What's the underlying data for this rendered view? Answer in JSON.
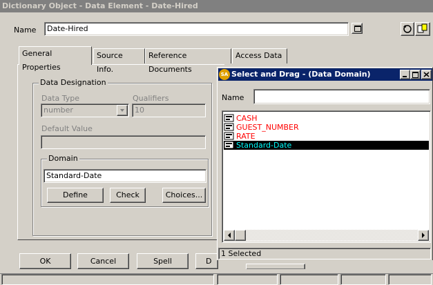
{
  "main_window": {
    "title": "Dictionary Object - Data Element - Date-Hired",
    "name_label": "Name",
    "name_value": "Date-Hired",
    "tabs": [
      {
        "label": "General Properties"
      },
      {
        "label": "Source Info."
      },
      {
        "label": "Reference Documents"
      },
      {
        "label": "Access Data"
      }
    ],
    "data_designation": {
      "legend": "Data Designation",
      "data_type_label": "Data Type",
      "data_type_value": "number",
      "qualifiers_label": "Qualifiers",
      "qualifiers_value": "10",
      "default_value_label": "Default Value",
      "default_value": ""
    },
    "domain": {
      "legend": "Domain",
      "value": "Standard-Date",
      "define_label": "Define",
      "check_label": "Check",
      "choices_label": "Choices..."
    },
    "buttons": {
      "ok": "OK",
      "cancel": "Cancel",
      "spell": "Spell",
      "partial": "D"
    }
  },
  "dialog": {
    "app_badge": "SA",
    "title": "Select and Drag - (Data Domain)",
    "name_label": "Name",
    "name_value": "",
    "items": [
      {
        "label": "CASH",
        "selected": false
      },
      {
        "label": "GUEST_NUMBER",
        "selected": false
      },
      {
        "label": "RATE",
        "selected": false
      },
      {
        "label": "Standard-Date",
        "selected": true
      }
    ],
    "status": "1 Selected",
    "colors": {
      "item_text": "#ff0000",
      "selected_text": "#00ffff",
      "selected_bg": "#000000",
      "title_bg": "#0a246a"
    }
  }
}
